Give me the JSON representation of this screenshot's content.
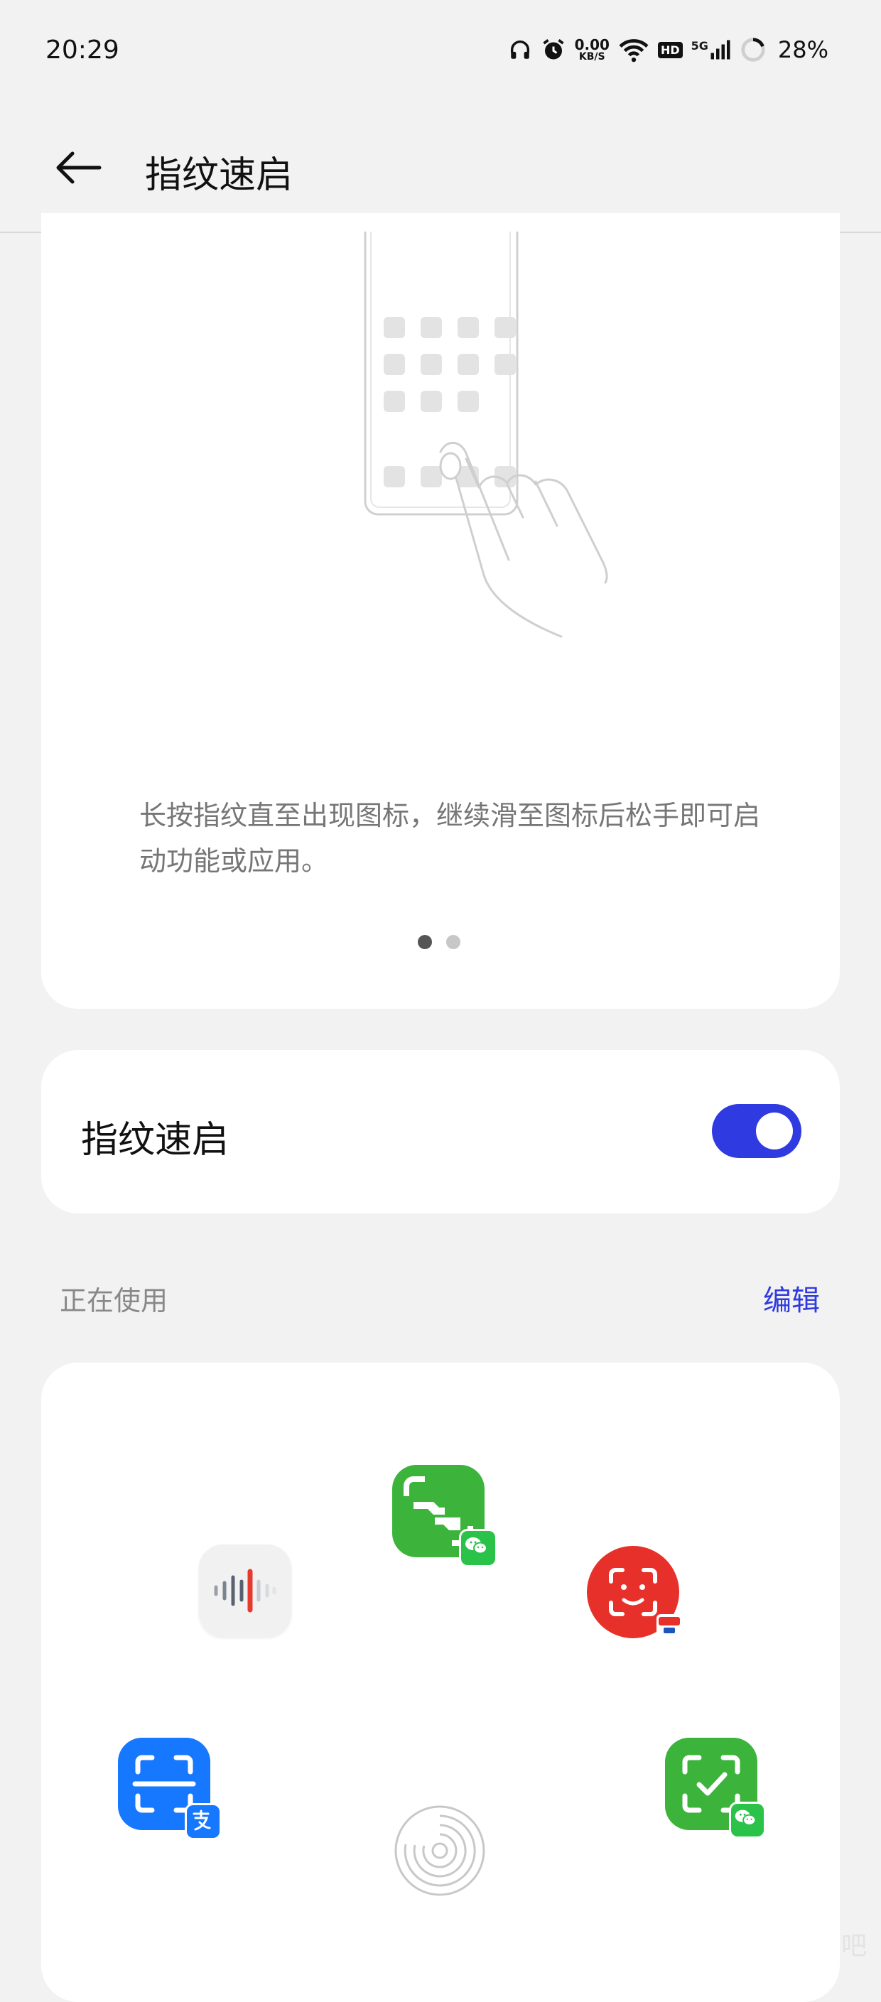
{
  "status_bar": {
    "time": "20:29",
    "net_speed_value": "0.00",
    "net_speed_unit": "KB/S",
    "hd": "HD",
    "signal_label": "5G",
    "battery_percent": "28%",
    "icons": [
      "headphones-icon",
      "alarm-icon",
      "wifi-icon",
      "hd-icon",
      "signal-icon",
      "battery-ring-icon"
    ]
  },
  "header": {
    "title": "指纹速启",
    "back_icon": "back-arrow-icon"
  },
  "tutorial": {
    "description": "长按指纹直至出现图标，继续滑至图标后松手即可启动功能或应用。",
    "page_indicator": {
      "total": 2,
      "current": 1
    }
  },
  "toggle_row": {
    "label": "指纹速启",
    "enabled": true
  },
  "in_use": {
    "section_label": "正在使用",
    "edit_label": "编辑",
    "shortcuts": [
      {
        "name": "voice-recorder-icon"
      },
      {
        "name": "wechat-scan-icon"
      },
      {
        "name": "face-scan-icon"
      },
      {
        "name": "alipay-scan-icon"
      },
      {
        "name": "wechat-pay-scan-icon"
      }
    ],
    "center_icon": "fingerprint-icon"
  },
  "colors": {
    "accent": "#2f3be0",
    "background": "#f2f2f2",
    "card": "#ffffff",
    "wechat_green": "#3cb43c",
    "alipay_blue": "#1677ff",
    "red": "#e8302a"
  },
  "watermark": "吧"
}
